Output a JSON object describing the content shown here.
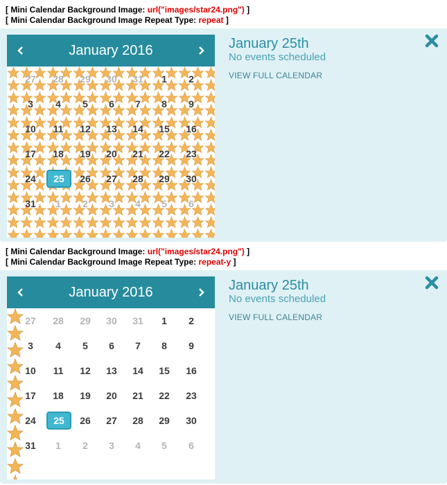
{
  "examples": [
    {
      "caption_line1_label": "[ Mini Calendar Background Image: ",
      "caption_line1_value": "url(\"images/star24.png\")",
      "caption_line1_end": " ]",
      "caption_line2_label": "[ Mini Calendar Background Image Repeat Type: ",
      "caption_line2_value": "repeat",
      "caption_line2_end": " ]",
      "repeat_mode": "repeat",
      "month_title": "January 2016",
      "prev_icon": "chevron-left-icon",
      "next_icon": "chevron-right-icon",
      "event_date": "January 25th",
      "event_status": "No events scheduled",
      "view_link": "VIEW FULL CALENDAR",
      "close_icon": "close-icon"
    },
    {
      "caption_line1_label": "[ Mini Calendar Background Image: ",
      "caption_line1_value": "url(\"images/star24.png\")",
      "caption_line1_end": " ]",
      "caption_line2_label": "[ Mini Calendar Background Image Repeat Type: ",
      "caption_line2_value": "repeat-y",
      "caption_line2_end": " ]",
      "repeat_mode": "repeat-y",
      "month_title": "January 2016",
      "prev_icon": "chevron-left-icon",
      "next_icon": "chevron-right-icon",
      "event_date": "January 25th",
      "event_status": "No events scheduled",
      "view_link": "VIEW FULL CALENDAR",
      "close_icon": "close-icon"
    }
  ],
  "calendar_days": [
    [
      "27",
      "28",
      "29",
      "30",
      "31",
      "1",
      "2"
    ],
    [
      "3",
      "4",
      "5",
      "6",
      "7",
      "8",
      "9"
    ],
    [
      "10",
      "11",
      "12",
      "13",
      "14",
      "15",
      "16"
    ],
    [
      "17",
      "18",
      "19",
      "20",
      "21",
      "22",
      "23"
    ],
    [
      "24",
      "25",
      "26",
      "27",
      "28",
      "29",
      "30"
    ],
    [
      "31",
      "1",
      "2",
      "3",
      "4",
      "5",
      "6"
    ]
  ],
  "other_month_days": [
    [
      0,
      0
    ],
    [
      0,
      1
    ],
    [
      0,
      2
    ],
    [
      0,
      3
    ],
    [
      0,
      4
    ],
    [
      5,
      1
    ],
    [
      5,
      2
    ],
    [
      5,
      3
    ],
    [
      5,
      4
    ],
    [
      5,
      5
    ],
    [
      5,
      6
    ]
  ],
  "selected_day": [
    4,
    1
  ],
  "colors": {
    "header": "#268c9d",
    "panel": "#dff1f5",
    "selected": "#41b8d1",
    "caption_value": "#e00000",
    "accent_text": "#2b8ea3"
  }
}
